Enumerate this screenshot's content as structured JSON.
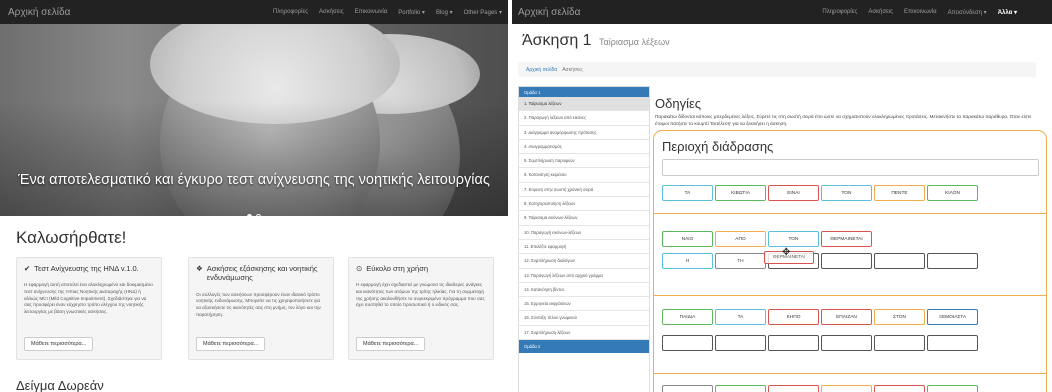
{
  "left": {
    "brand": "Αρχική σελίδα",
    "nav": [
      "Πληροφορίες",
      "Ασκήσεις",
      "Επικοινωνία",
      "Portfolio ▾",
      "Blog ▾",
      "Other Pages ▾"
    ],
    "hero_caption": "Ένα αποτελεσματικό και έγκυρο τεστ ανίχνευσης της νοητικής λειτουργίας",
    "welcome": "Καλωσήρθατε!",
    "cards": [
      {
        "icon": "check-icon",
        "title": "Τεστ Ανίχνευσης της ΗΝΔ v.1.0.",
        "text": "Η εφαρμογή αυτή αποτελεί ένα ολοκληρωμένο και δοκιμασμένο τεστ ανίχνευσης της Ήπιας Νοητικής Διαταραχής (ΗΝΔ) ή αλλιώς MCI (Mild Cognitive Impairment). Σχεδιάστηκε για να σας προσφέρει έναν εύχρηστο τρόπο ελέγχου της νοητικής λειτουργίας με βάση γνωστικές ασκήσεις.",
        "button": "Μάθετε περισσότερα..."
      },
      {
        "icon": "gift-icon",
        "title": "Ασκήσεις εξάσκησης και νοητικής ενδυνάμωσης",
        "text": "Οι συλλογές των ασκήσεων προσφέρουν έναν ιδανικό τρόπο νοητικής ενδυνάμωσης. Μπορείτε να τις χρησιμοποιήσετε για να εξασκήσετε τις ικανότητές σας στη μνήμη, τον λόγο και την παρατήρηση.",
        "button": "Μάθετε περισσότερα..."
      },
      {
        "icon": "compass-icon",
        "title": "Εύκολο στη χρήση",
        "text": "Η εφαρμογή έχει σχεδιαστεί με γνώμονα τις ιδιαίτερες ανάγκες και ικανότητες των ατόμων της τρίτης ηλικίας. Για τη συμμετοχή της χρήσης ακολουθήστε το συγκεκριμένο πρόγραμμα που σας έχει συστηθεί το οποίο προσωπικό ή ο ειδικός σας.",
        "button": "Μάθετε περισσότερα..."
      }
    ],
    "section_heading": "Δείγμα Δωρεάν"
  },
  "right": {
    "brand": "Αρχική σελίδα",
    "nav": [
      "Πληροφορίες",
      "Ασκήσεις",
      "Επικοινωνία",
      "Αποσύνδεση ▾",
      "Άλλα ▾"
    ],
    "active_nav": "Άλλα ▾",
    "title": "Άσκηση 1",
    "subtitle": "Ταίριασμα λέξεων",
    "breadcrumb": {
      "home": "Αρχική σελίδα",
      "current": "Ασκήσεις"
    },
    "sidebar": {
      "header": "Ομάδα 1",
      "items": [
        "1. Ταίριασμα λέξεων",
        "2. Παραγωγή λέξεων από εικόνες",
        "3. Διάγραμμα αναμόρφωσης πρότασης",
        "4. Αναγραμματισμός",
        "5. Συμπλήρωση παροιμιών",
        "6. Κατανόηση κειμένου",
        "7. Εύρεση στην σωστή χρονική σειρά",
        "8. Κατηγοριοποίηση λέξεων",
        "9. Ταίριασμα εικόνων-λέξεων",
        "10. Παραγωγή εικόνων-λέξεων",
        "11. Επιλέξτε εφαρμογή",
        "12. Συμπλήρωση διαλόγων",
        "13. Παραγωγή λέξεων από αρχικό γράμμα",
        "14. Κατανόηση βίντεο",
        "15. Ερμηνεία εκφράσεων",
        "16. Σύνταξη τίτλου γνωμικού",
        "17. Συμπλήρωση λέξεων"
      ],
      "active_index": 0,
      "footer": "Ομάδα 2"
    },
    "instructions_title": "Οδηγίες",
    "instructions_text": "Παρακάτω δίδονται κάποιες μπερδεμένες λέξεις. Σύρετέ τις στη σωστή σειρά έτσι ώστε να σχηματιστούν ολοκληρωμένες προτάσεις. Μετακινήστε τα παρακάτω παράθυρα. Όταν είστε έτοιμοι πατήστε το κουμπί 'Εκτέλεση' για να ξεκινήσει η άσκηση.",
    "area_title": "Περιοχή διάδρασης",
    "rows": [
      [
        {
          "text": "ΤΑ",
          "color": "cyan"
        },
        {
          "text": "ΚΙΒΩΤΙΑ",
          "color": "green"
        },
        {
          "text": "ΕΙΝΑΙ",
          "color": "red"
        },
        {
          "text": "ΤΟΝ",
          "color": "cyan"
        },
        {
          "text": "ΠΕΝΤΕ",
          "color": "yellow"
        },
        {
          "text": "ΚΙΛΟΝ",
          "color": "green"
        }
      ],
      [
        {
          "text": "ΝΑΙΟ",
          "color": "green"
        },
        {
          "text": "ΑΠΟ",
          "color": "yellow"
        },
        {
          "text": "ΤΟΝ",
          "color": "cyan"
        },
        {
          "text": "ΘΕΡΜΑΙΝΕΤΑΙ",
          "color": "red"
        }
      ],
      [
        {
          "text": "Η",
          "color": "cyan"
        },
        {
          "text": "ΓΗ",
          "color": "gray"
        },
        {
          "text": "",
          "color": "empty"
        },
        {
          "text": "",
          "color": "empty"
        },
        {
          "text": "",
          "color": "empty"
        },
        {
          "text": "",
          "color": "empty"
        }
      ],
      [
        {
          "text": "ΠΑΙΔΙΑ",
          "color": "green"
        },
        {
          "text": "ΤΑ",
          "color": "cyan"
        },
        {
          "text": "ΚΗΠΟ",
          "color": "red"
        },
        {
          "text": "ΕΠΑΙΖΑΝ",
          "color": "red"
        },
        {
          "text": "ΣΤΟΝ",
          "color": "yellow"
        },
        {
          "text": "ΞΕΜΟΙΑΣΤΑ",
          "color": "blue"
        }
      ],
      [
        {
          "text": "",
          "color": "empty"
        },
        {
          "text": "",
          "color": "empty"
        },
        {
          "text": "",
          "color": "empty"
        },
        {
          "text": "",
          "color": "empty"
        },
        {
          "text": "",
          "color": "empty"
        },
        {
          "text": "",
          "color": "empty"
        }
      ],
      [
        {
          "text": "",
          "color": "gray"
        },
        {
          "text": "",
          "color": "green"
        },
        {
          "text": "",
          "color": "red"
        },
        {
          "text": "",
          "color": "yellow"
        },
        {
          "text": "",
          "color": "red"
        },
        {
          "text": "",
          "color": "green"
        }
      ]
    ],
    "drag_ghost": "ΘΕΡΜΑΙΝΕΤΑΙ"
  },
  "colors": {
    "navbar": "#222222",
    "primary": "#337ab7",
    "cyan": "#5bc0de",
    "green": "#5cb85c",
    "red": "#d9534f",
    "yellow": "#f0ad4e",
    "area_border": "#f0ad4e"
  }
}
